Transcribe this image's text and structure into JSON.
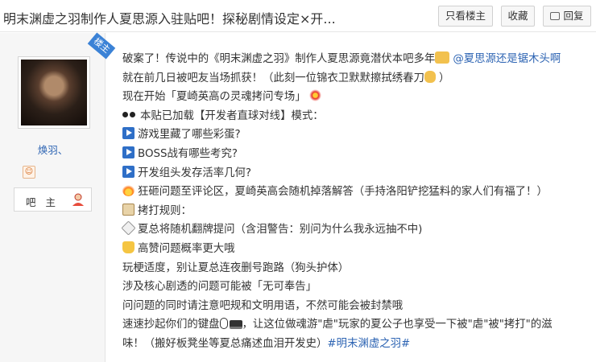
{
  "header": {
    "title": "明末渊虚之羽制作人夏思源入驻贴吧！探秘剧情设定×开...",
    "btn_author_only": "只看楼主",
    "btn_favorite": "收藏",
    "btn_reply": "回复"
  },
  "author": {
    "floor_tag": "楼主",
    "name": "焕羽、",
    "role": "吧 主"
  },
  "post": {
    "l1_a": "破案了！传说中的《明末渊虚之羽》制作人夏思源竟潜伏本吧多年",
    "l1_mention": "@夏思源还是锯木头啊",
    "l2": "就在前几日被吧友当场抓获！（此刻一位锦衣卫默默擦拭绣春刀",
    "l2_end": "）",
    "l3": "现在开始「夏崎英高の灵魂拷问专场」",
    "l4": "本贴已加载【开发者直球对线】模式：",
    "l5": "游戏里藏了哪些彩蛋?",
    "l6": "BOSS战有哪些考究?",
    "l7": "开发组头发存活率几何?",
    "l8": "狂砸问题至评论区，夏崎英高会随机掉落解答（手持洛阳铲挖猛料的家人们有福了！）",
    "l9": "拷打规则：",
    "l10": "夏总将随机翻牌提问（含泪警告：别问为什么我永远抽不中)",
    "l11": "高赞问题概率更大哦",
    "l12": "玩梗适度，别让夏总连夜删号跑路（狗头护体）",
    "l13": "涉及核心剧透的问题可能被「无可奉告」",
    "l14": "问问题的同时请注意吧规和文明用语，不然可能会被封禁哦",
    "l15_a": "速速抄起你们的键盘",
    "l15_b": "，让这位做魂游\"虐\"玩家的夏公子也享受一下被\"虐\"被\"拷打\"的滋",
    "l16_a": "味！（搬好板凳坐等夏总痛述血泪开发史）",
    "l16_tag": "#明末渊虚之羽#"
  },
  "colors": {
    "link": "#2d64b3",
    "floor_tag": "#3b82d6"
  }
}
